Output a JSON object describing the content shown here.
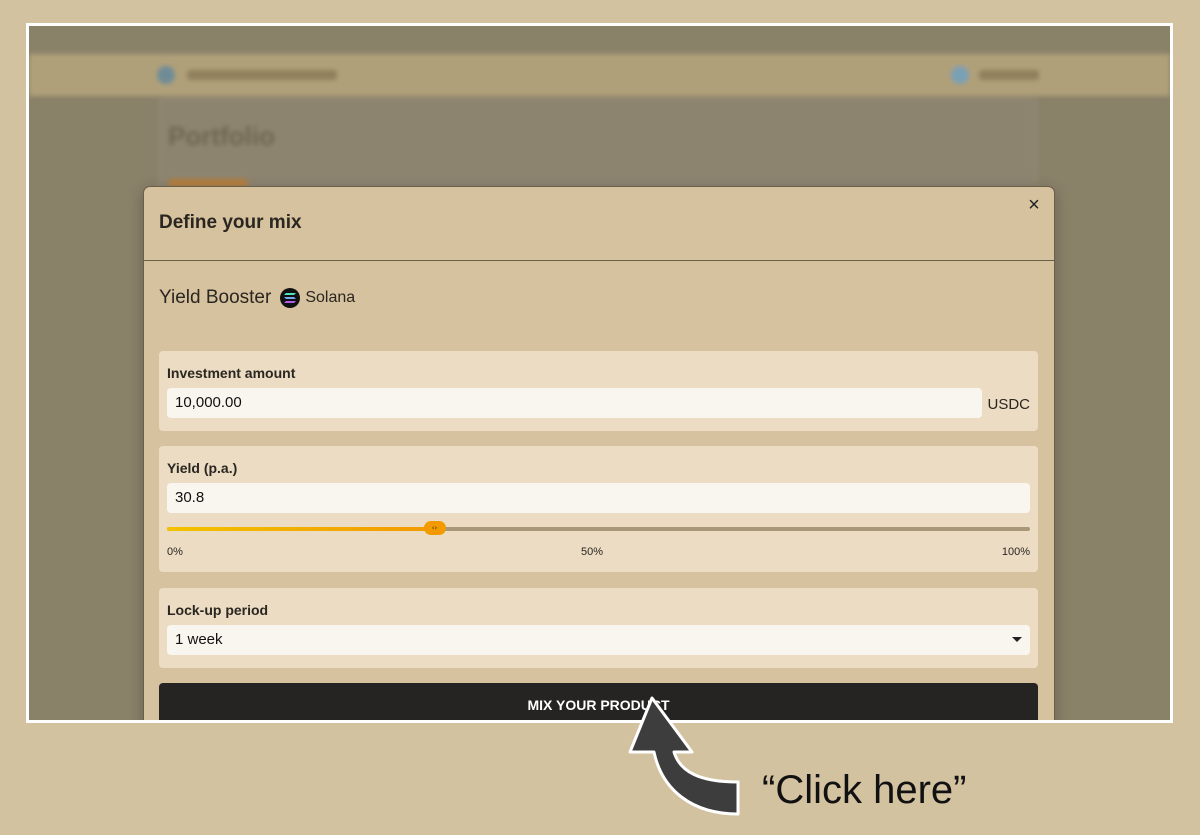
{
  "modal": {
    "title": "Define your mix",
    "close_label": "×",
    "product": {
      "name": "Yield Booster",
      "chain_icon": "solana-icon",
      "chain_name": "Solana"
    },
    "investment": {
      "label": "Investment amount",
      "value": "10,000.00",
      "unit": "USDC"
    },
    "yield": {
      "label": "Yield (p.a.)",
      "value": "30.8",
      "slider_fraction": 0.31,
      "ticks": [
        "0%",
        "50%",
        "100%"
      ],
      "thumb_glyph": "‹›"
    },
    "lockup": {
      "label": "Lock-up period",
      "selected": "1 week"
    },
    "cta_label": "MIX YOUR PRODUCT"
  },
  "background": {
    "card_title": "Portfolio"
  },
  "annotation": {
    "text": "“Click here”"
  },
  "colors": {
    "page_bg": "#d3c2a0",
    "overlay": "#8a8169",
    "modal_bg": "#d7c29f",
    "panel_bg": "#ebdcc3",
    "cta_bg": "#262422",
    "slider_accent": "#f39a00"
  }
}
